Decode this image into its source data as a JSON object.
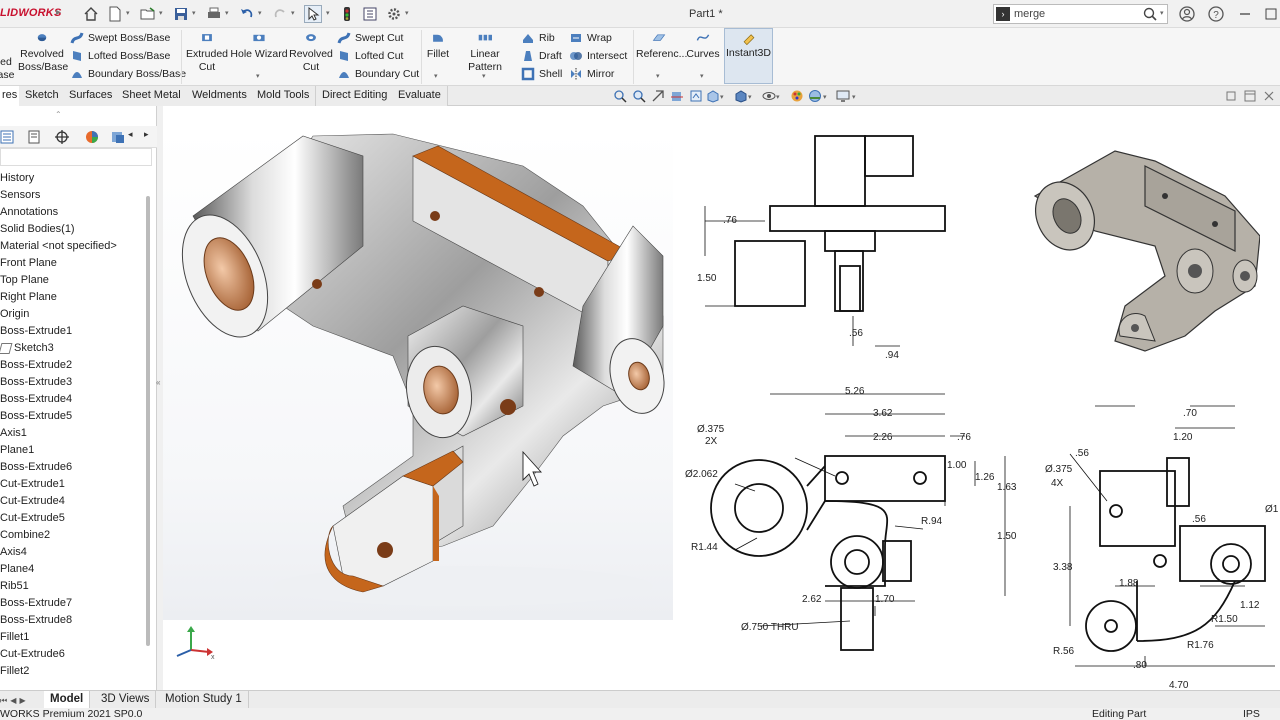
{
  "titlebar": {
    "logo": "LIDWORKS",
    "title": "Part1 *",
    "search_value": "merge",
    "icons": [
      "home-icon",
      "new-document-icon",
      "open-folder-icon",
      "save-icon",
      "print-icon",
      "undo-icon",
      "redo-icon",
      "select-arrow-icon",
      "traffic-light-icon",
      "file-properties-icon",
      "gear-icon",
      "user-icon",
      "help-icon",
      "minimize-icon",
      "restore-icon",
      "close-icon"
    ]
  },
  "ribbon": {
    "big_buttons": [
      {
        "label1": "ed",
        "label2": "ase",
        "icon": "extruded-boss-icon"
      },
      {
        "label1": "Revolved",
        "label2": "Boss/Base",
        "icon": "revolved-boss-icon"
      },
      {
        "label1": "Extruded",
        "label2": "Cut",
        "icon": "extruded-cut-icon"
      },
      {
        "label1": "Hole Wizard",
        "label2": "",
        "icon": "hole-wizard-icon"
      },
      {
        "label1": "Revolved",
        "label2": "Cut",
        "icon": "revolved-cut-icon"
      },
      {
        "label1": "Fillet",
        "label2": "",
        "icon": "fillet-icon"
      },
      {
        "label1": "Linear Pattern",
        "label2": "",
        "icon": "linear-pattern-icon"
      },
      {
        "label1": "Referenc...",
        "label2": "",
        "icon": "reference-geometry-icon"
      },
      {
        "label1": "Curves",
        "label2": "",
        "icon": "curves-icon"
      },
      {
        "label1": "Instant3D",
        "label2": "",
        "icon": "instant3d-icon"
      }
    ],
    "small_buttons": [
      {
        "label": "Swept Boss/Base",
        "icon": "swept-boss-icon"
      },
      {
        "label": "Lofted Boss/Base",
        "icon": "lofted-boss-icon"
      },
      {
        "label": "Boundary Boss/Base",
        "icon": "boundary-boss-icon"
      },
      {
        "label": "Swept Cut",
        "icon": "swept-cut-icon"
      },
      {
        "label": "Lofted Cut",
        "icon": "lofted-cut-icon"
      },
      {
        "label": "Boundary Cut",
        "icon": "boundary-cut-icon"
      },
      {
        "label": "Rib",
        "icon": "rib-icon"
      },
      {
        "label": "Draft",
        "icon": "draft-icon"
      },
      {
        "label": "Shell",
        "icon": "shell-icon"
      },
      {
        "label": "Wrap",
        "icon": "wrap-icon"
      },
      {
        "label": "Intersect",
        "icon": "intersect-icon"
      },
      {
        "label": "Mirror",
        "icon": "mirror-icon"
      }
    ]
  },
  "tabs": [
    "res",
    "Sketch",
    "Surfaces",
    "Sheet Metal",
    "Weldments",
    "Mold Tools",
    "Direct Editing",
    "Evaluate"
  ],
  "feature_tree": {
    "nodes": [
      "History",
      "Sensors",
      "Annotations",
      "Solid Bodies(1)",
      "Material <not specified>",
      "Front Plane",
      "Top Plane",
      "Right Plane",
      "Origin",
      "Boss-Extrude1",
      "Sketch3",
      "Boss-Extrude2",
      "Boss-Extrude3",
      "Boss-Extrude4",
      "Boss-Extrude5",
      "Axis1",
      "Plane1",
      "Boss-Extrude6",
      "Cut-Extrude1",
      "Cut-Extrude4",
      "Cut-Extrude5",
      "Combine2",
      "Axis4",
      "Plane4",
      "Rib51",
      "Boss-Extrude7",
      "Boss-Extrude8",
      "Fillet1",
      "Cut-Extrude6",
      "Fillet2"
    ]
  },
  "drawing": {
    "front_view": {
      "d1": ".76",
      "d2": "1.50",
      "d3": ".56",
      "d4": ".94"
    },
    "top_view": {
      "d1": "5.26",
      "d2": "3.62",
      "d3": "2.26",
      "d4": ".76",
      "d5": "Ø.375",
      "d6": "2X",
      "d7": "Ø2.062",
      "d8": "1.00",
      "d9": "1.26",
      "d10": "1.63",
      "d11": "R.94",
      "d12": "R1.44",
      "d13": "1.50",
      "d14": "2.62",
      "d15": "1.70",
      "d16": "Ø.750 THRU"
    },
    "side_view": {
      "d1": ".70",
      "d2": "1.20",
      "d3": ".56",
      "d4": "Ø.375",
      "d5": "4X",
      "d6": ".56",
      "d7": "Ø1",
      "d8": "3.38",
      "d9": "1.88",
      "d10": "1.12",
      "d11": "R1.50",
      "d12": "R1.76",
      "d13": "R.56",
      "d14": ".80",
      "d15": "4.70"
    }
  },
  "bottom_tabs": [
    "Model",
    "3D Views",
    "Motion Study 1"
  ],
  "status": {
    "product": "WORKS Premium 2021 SP0.0",
    "mode": "Editing Part",
    "units": "IPS"
  },
  "colors": {
    "accent_orange": "#c5661c",
    "highlight": "#dde6f0",
    "brand_red": "#c8102e"
  }
}
